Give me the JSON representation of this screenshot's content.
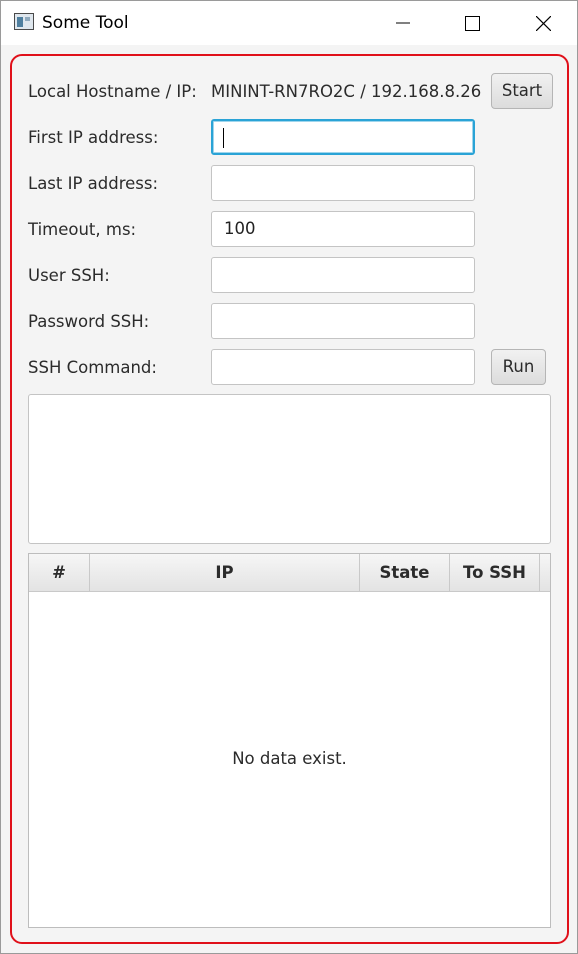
{
  "window": {
    "title": "Some Tool"
  },
  "form": {
    "local_label": "Local Hostname / IP:",
    "local_value": "MININT-RN7RO2C / 192.168.8.26",
    "start_button": "Start",
    "first_ip_label": "First IP address:",
    "first_ip_value": "",
    "last_ip_label": "Last IP address:",
    "last_ip_value": "",
    "timeout_label": "Timeout, ms:",
    "timeout_value": "100",
    "user_label": "User SSH:",
    "user_value": "",
    "password_label": "Password SSH:",
    "password_value": "",
    "command_label": "SSH Command:",
    "command_value": "",
    "run_button": "Run"
  },
  "table": {
    "columns": [
      "#",
      "IP",
      "State",
      "To SSH"
    ],
    "empty_text": "No data exist."
  },
  "colors": {
    "focus": "#2aa3d6",
    "highlight_frame": "#e0101a"
  }
}
